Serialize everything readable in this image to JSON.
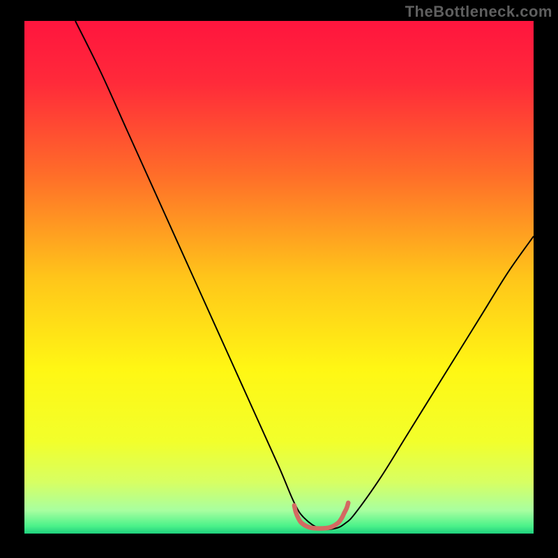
{
  "watermark": "TheBottleneck.com",
  "chart_data": {
    "type": "line",
    "title": "",
    "xlabel": "",
    "ylabel": "",
    "xlim": [
      0,
      100
    ],
    "ylim": [
      0,
      100
    ],
    "grid": false,
    "legend": false,
    "background_gradient": {
      "stops": [
        {
          "offset": 0,
          "color": "#ff153e"
        },
        {
          "offset": 0.12,
          "color": "#ff2a3a"
        },
        {
          "offset": 0.3,
          "color": "#ff6d29"
        },
        {
          "offset": 0.5,
          "color": "#ffc51a"
        },
        {
          "offset": 0.68,
          "color": "#fff714"
        },
        {
          "offset": 0.82,
          "color": "#f2ff2b"
        },
        {
          "offset": 0.9,
          "color": "#d7ff63"
        },
        {
          "offset": 0.955,
          "color": "#a8ffa0"
        },
        {
          "offset": 0.985,
          "color": "#4cf28a"
        },
        {
          "offset": 1.0,
          "color": "#1fd07e"
        }
      ]
    },
    "series": [
      {
        "name": "bottleneck-curve",
        "color": "#000000",
        "width": 2,
        "x": [
          10,
          15,
          20,
          25,
          30,
          35,
          40,
          45,
          50,
          53,
          55,
          58,
          61,
          63,
          65,
          70,
          75,
          80,
          85,
          90,
          95,
          100
        ],
        "y": [
          100,
          90,
          79,
          68,
          57,
          46,
          35,
          24,
          13,
          6,
          3,
          1,
          1,
          2,
          4,
          11,
          19,
          27,
          35,
          43,
          51,
          58
        ]
      },
      {
        "name": "optimal-marker",
        "color": "#d36a62",
        "width": 6.5,
        "linecap": "round",
        "x": [
          53.0,
          53.3,
          53.8,
          54.5,
          56.0,
          58.0,
          60.0,
          61.5,
          62.3,
          62.8,
          63.3,
          63.6
        ],
        "y": [
          5.5,
          4.2,
          3.0,
          2.0,
          1.2,
          1.0,
          1.2,
          2.0,
          3.0,
          4.0,
          5.0,
          6.0
        ]
      }
    ]
  }
}
